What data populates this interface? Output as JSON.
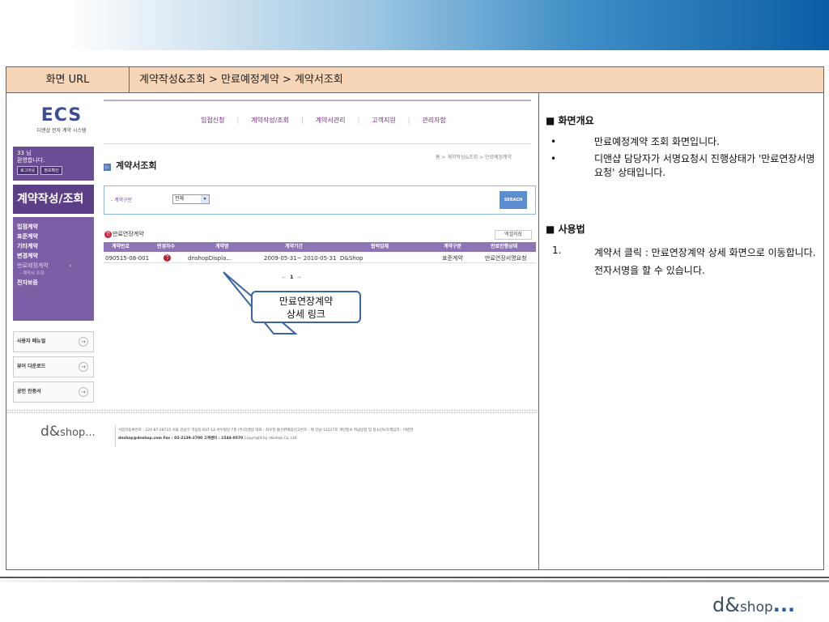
{
  "header": {
    "url_key": "화면 URL",
    "url_value": "계약작성&조회 > 만료예정계약 > 계약서조회"
  },
  "screen": {
    "logo_main": "ECS",
    "logo_sub": "디앤샵 전자 계약 시스템",
    "gnb": [
      "입점신청",
      "계약작성/조회",
      "계약서관리",
      "고객지원",
      "관리자함"
    ],
    "login_greeting_1": "33 님",
    "login_greeting_2": "환영합니다.",
    "logout_btn": "로그아웃",
    "info_btn": "정보확인",
    "sidebar_title": "계약작성/조회",
    "sidebar_menu": [
      "입점계약",
      "표준계약",
      "기타계약",
      "변경계약"
    ],
    "sidebar_menu_expired": "만료예정계약",
    "sidebar_menu_expired_arrow": "›",
    "sidebar_sub": "- 계약서 조회",
    "sidebar_menu_last": "전자보증",
    "sidebar_boxes": [
      "사용자 메뉴얼",
      "뷰어 다운로드",
      "공인 인증서"
    ],
    "sidebar_box_arrow": "→",
    "breadcrumb": "홈 > 계약작성&조회 > 만료예정계약",
    "title_mark": "▷",
    "page_title": "계약서조회",
    "search_label": "- 계약구분",
    "search_select": "전체",
    "select_arrow": "▾",
    "search_btn": "SERACH",
    "list_badge": "연",
    "list_title": "만료연장계약",
    "excel_btn": "엑셀저장",
    "table_headers": [
      "계약번호",
      "변경차수",
      "계약명",
      "계약기간",
      "협력업체",
      "계약구분",
      "만료진행상태"
    ],
    "table_row": {
      "number": "090515-08-001",
      "badge": "연",
      "revision": "01",
      "name": "dnshopDispla...",
      "period": "2009-05-31~ 2010-05-31",
      "partner": "D&Shop",
      "type": "표준계약",
      "status": "만료연장서명요청"
    },
    "pager": {
      "prev": "«‹",
      "page": "1",
      "next": "›»"
    },
    "footer_logo": "d&",
    "footer_logo_small": "shop...",
    "footer_line1": "사업자등록번호 : 220-87-28715  서울 강남구 역삼동 837-12 서우빌딩 7층 (주)디앤샵  대표 : 최우정 통신판매업신고번호 : 제 강남-11217호 개인정보 취급방침 및 청소년보호책임자 : 이병현",
    "footer_line2_bold": "dnshop@dnshop.com  Fax : 02-2139-2700  고객센터 : 1544-0570",
    "footer_line2_rest": "  Copyright by d&shop.Co.,Ltd"
  },
  "callout": {
    "line1": "만료연장계약",
    "line2": "상세 링크"
  },
  "panel": {
    "overview_title": "■ 화면개요",
    "overview_items": [
      "만료예정계약 조회 화면입니다.",
      "디앤샵 담당자가 서명요청시 진행상태가 '만료연장서명요청' 상태입니다."
    ],
    "bullet": "•",
    "usage_title": "■ 사용법",
    "usage_num": "1.",
    "usage_text": "계약서 클릭 : 만료연장계약 상세 화면으로 이동합니다. 전자서명을 할 수 있습니다."
  },
  "brand": {
    "main": "d&",
    "small": "shop",
    "dots": "..."
  }
}
